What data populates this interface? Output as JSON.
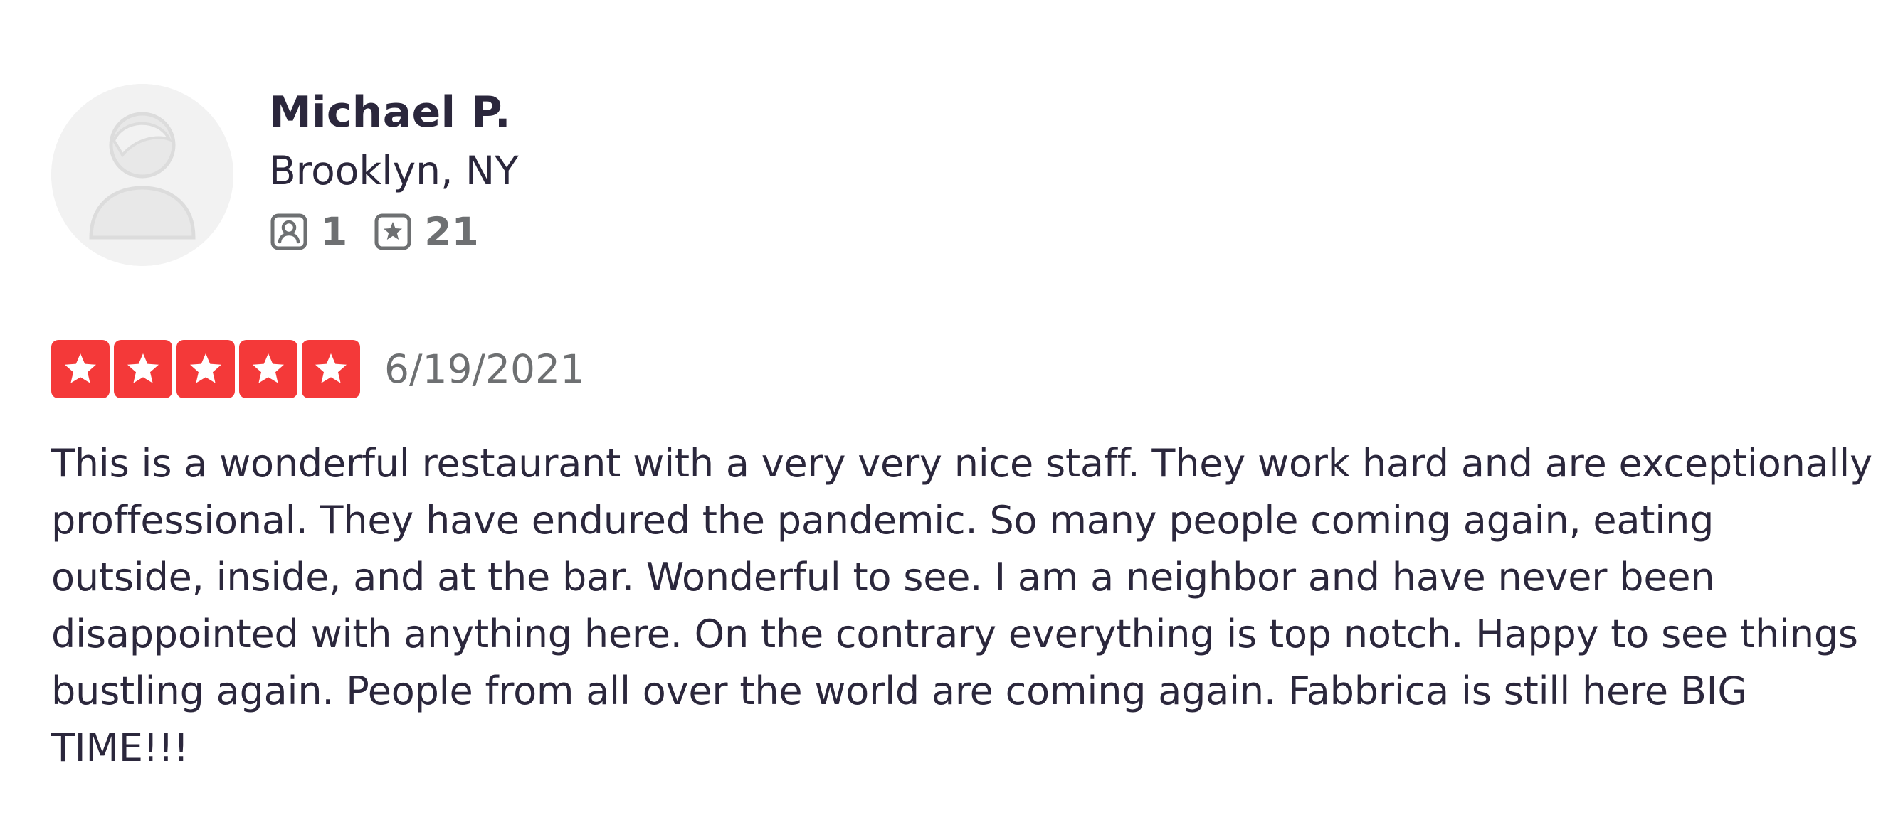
{
  "user": {
    "name": "Michael P.",
    "location": "Brooklyn, NY",
    "friends_count": "1",
    "reviews_count": "21",
    "avatar_icon": "default-avatar-icon"
  },
  "review": {
    "rating": 5,
    "rating_max": 5,
    "date": "6/19/2021",
    "text": "This is a wonderful restaurant with a very very nice staff. They work hard and are exceptionally proffessional. They have endured the pandemic. So many people coming again, eating outside, inside, and at the bar. Wonderful to see. I am a neighbor and have never been disappointed with anything here. On the contrary everything is top notch. Happy to see things bustling again. People from all over the world are coming again. Fabbrica is still here BIG TIME!!!"
  },
  "colors": {
    "star_bg": "#f43939",
    "text_primary": "#2b273c",
    "text_muted": "#6e7072",
    "avatar_bg": "#f2f2f2"
  },
  "icons": {
    "friends": "friends-icon",
    "reviews": "reviews-icon",
    "star": "star-icon"
  }
}
